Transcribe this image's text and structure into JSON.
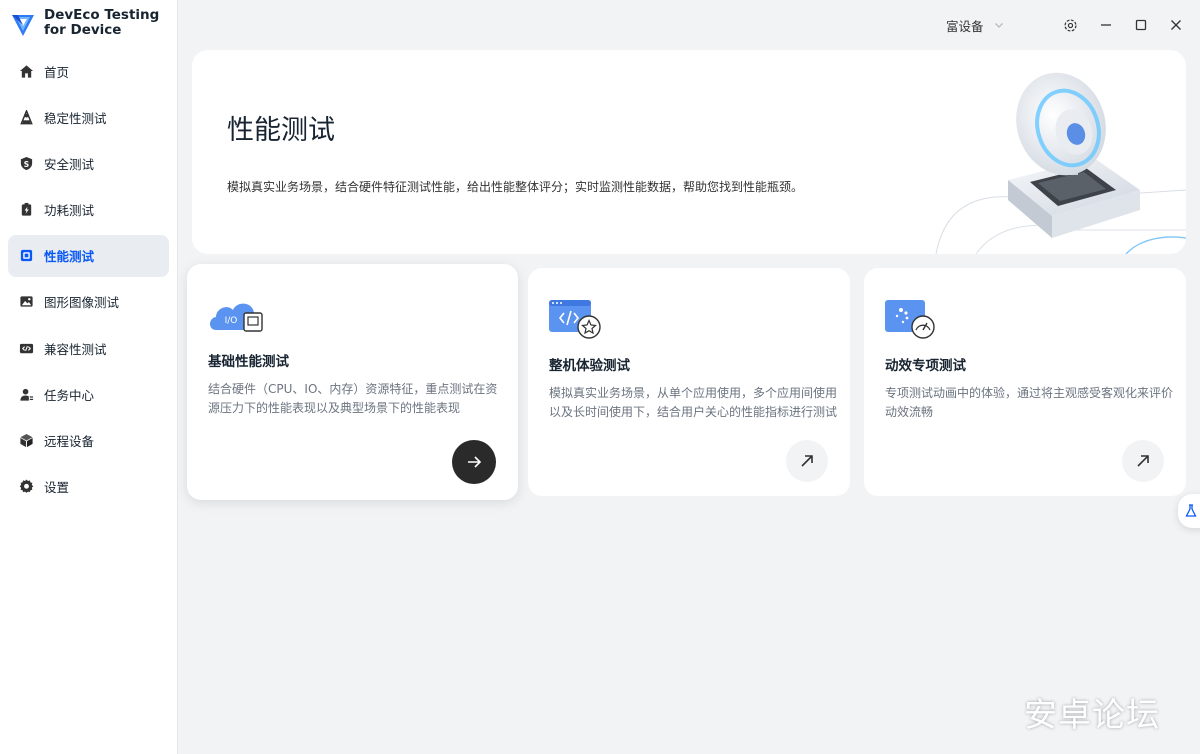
{
  "app": {
    "title_line1": "DevEco Testing",
    "title_line2": "for Device"
  },
  "sidebar": {
    "items": [
      {
        "label": "首页",
        "icon": "home-icon",
        "active": false
      },
      {
        "label": "稳定性测试",
        "icon": "stability-icon",
        "active": false
      },
      {
        "label": "安全测试",
        "icon": "shield-icon",
        "active": false
      },
      {
        "label": "功耗测试",
        "icon": "power-icon",
        "active": false
      },
      {
        "label": "性能测试",
        "icon": "chip-icon",
        "active": true
      },
      {
        "label": "图形图像测试",
        "icon": "image-icon",
        "active": false
      },
      {
        "label": "兼容性测试",
        "icon": "code-icon",
        "active": false
      },
      {
        "label": "任务中心",
        "icon": "user-task-icon",
        "active": false
      },
      {
        "label": "远程设备",
        "icon": "cube-icon",
        "active": false
      },
      {
        "label": "设置",
        "icon": "gear-icon",
        "active": false
      }
    ]
  },
  "titlebar": {
    "device_placeholder": "富设备"
  },
  "hero": {
    "title": "性能测试",
    "desc": "模拟真实业务场景，结合硬件特征测试性能，给出性能整体评分；实时监测性能数据，帮助您找到性能瓶颈。"
  },
  "cards": [
    {
      "title": "基础性能测试",
      "desc": "结合硬件（CPU、IO、内存）资源特征，重点测试在资源压力下的性能表现以及典型场景下的性能表现",
      "icon_text": "I/O",
      "active": true
    },
    {
      "title": "整机体验测试",
      "desc": "模拟真实业务场景，从单个应用使用，多个应用间使用以及长时间使用下，结合用户关心的性能指标进行测试",
      "active": false
    },
    {
      "title": "动效专项测试",
      "desc": "专项测试动画中的体验，通过将主观感受客观化来评价动效流畅",
      "active": false
    }
  ],
  "watermark": "安卓论坛",
  "colors": {
    "accent": "#0a59f7",
    "active_bg": "#e9edf2",
    "page_bg": "#f1f3f5"
  }
}
